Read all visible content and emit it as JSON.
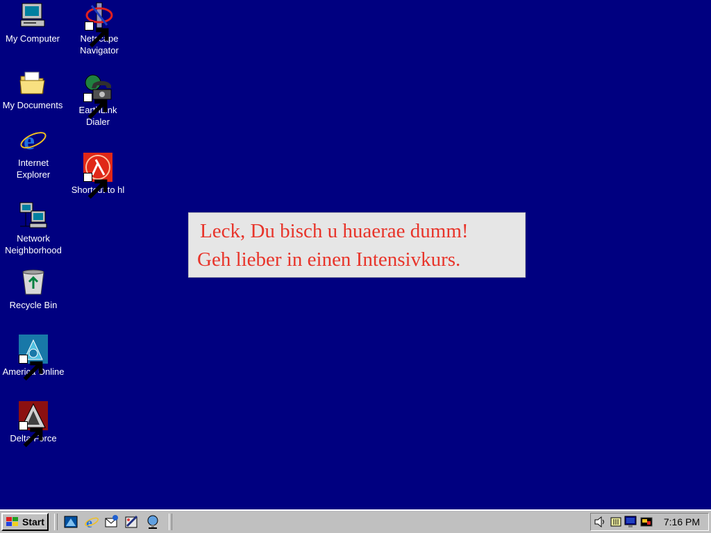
{
  "desktop": {
    "icons": [
      {
        "name": "my-computer",
        "label": "My Computer"
      },
      {
        "name": "my-documents",
        "label": "My Documents"
      },
      {
        "name": "internet-explorer",
        "label": "Internet\nExplorer"
      },
      {
        "name": "network-neighborhood",
        "label": "Network\nNeighborhood"
      },
      {
        "name": "recycle-bin",
        "label": "Recycle Bin"
      },
      {
        "name": "america-online",
        "label": "America Online"
      },
      {
        "name": "delta-force",
        "label": "Delta Force"
      },
      {
        "name": "netscape-navigator",
        "label": "Netscape\nNavigator"
      },
      {
        "name": "earthlink-dialer",
        "label": "EarthLink\nDialer"
      },
      {
        "name": "shortcut-to-hl",
        "label": "Shortcut to hl"
      }
    ]
  },
  "message": {
    "line1": "Leck, Du bisch u huaerae dumm!",
    "line2": "Geh lieber in einen Intensivkurs."
  },
  "taskbar": {
    "start_label": "Start",
    "clock": "7:16 PM",
    "quick_launch": [
      "show-desktop-icon",
      "internet-explorer-icon",
      "outlook-express-icon",
      "channels-icon",
      "media-player-icon"
    ],
    "tray": [
      "volume-icon",
      "battery-icon",
      "network-monitor-icon",
      "display-icon"
    ]
  },
  "colors": {
    "desktop": "#000080",
    "message_text": "#e8342a",
    "taskbar": "#c0c0c0"
  }
}
